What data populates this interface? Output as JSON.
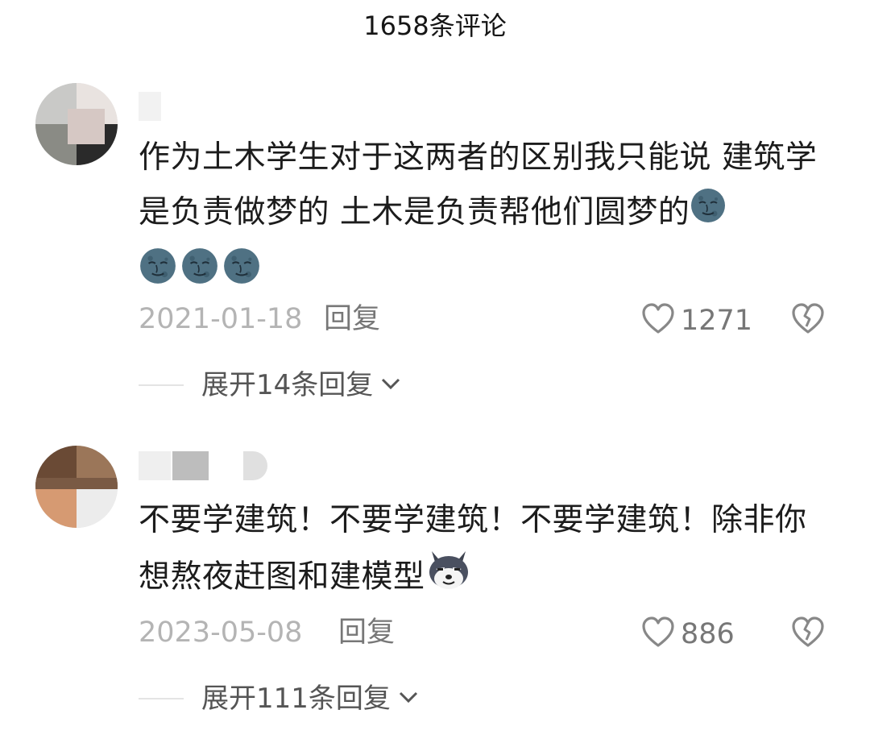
{
  "header": {
    "title": "1658条评论"
  },
  "comments": [
    {
      "text": "作为土木学生对于这两者的区别我只能说 建筑学是负责做梦的 土木是负责帮他们圆梦的",
      "emoji": "moon-face-emoji",
      "date": "2021-01-18",
      "reply_label": "回复",
      "likes": "1271",
      "expand_label": "展开14条回复"
    },
    {
      "text": "不要学建筑！不要学建筑！不要学建筑！除非你想熬夜赶图和建模型",
      "emoji": "husky-dog-emoji",
      "date": "2023-05-08",
      "reply_label": "回复",
      "likes": "886",
      "expand_label": "展开111条回复"
    }
  ],
  "colors": {
    "text": "#1c1c1c",
    "meta": "#b4b4b4",
    "secondary": "#777777",
    "moon": "#4f7183"
  }
}
